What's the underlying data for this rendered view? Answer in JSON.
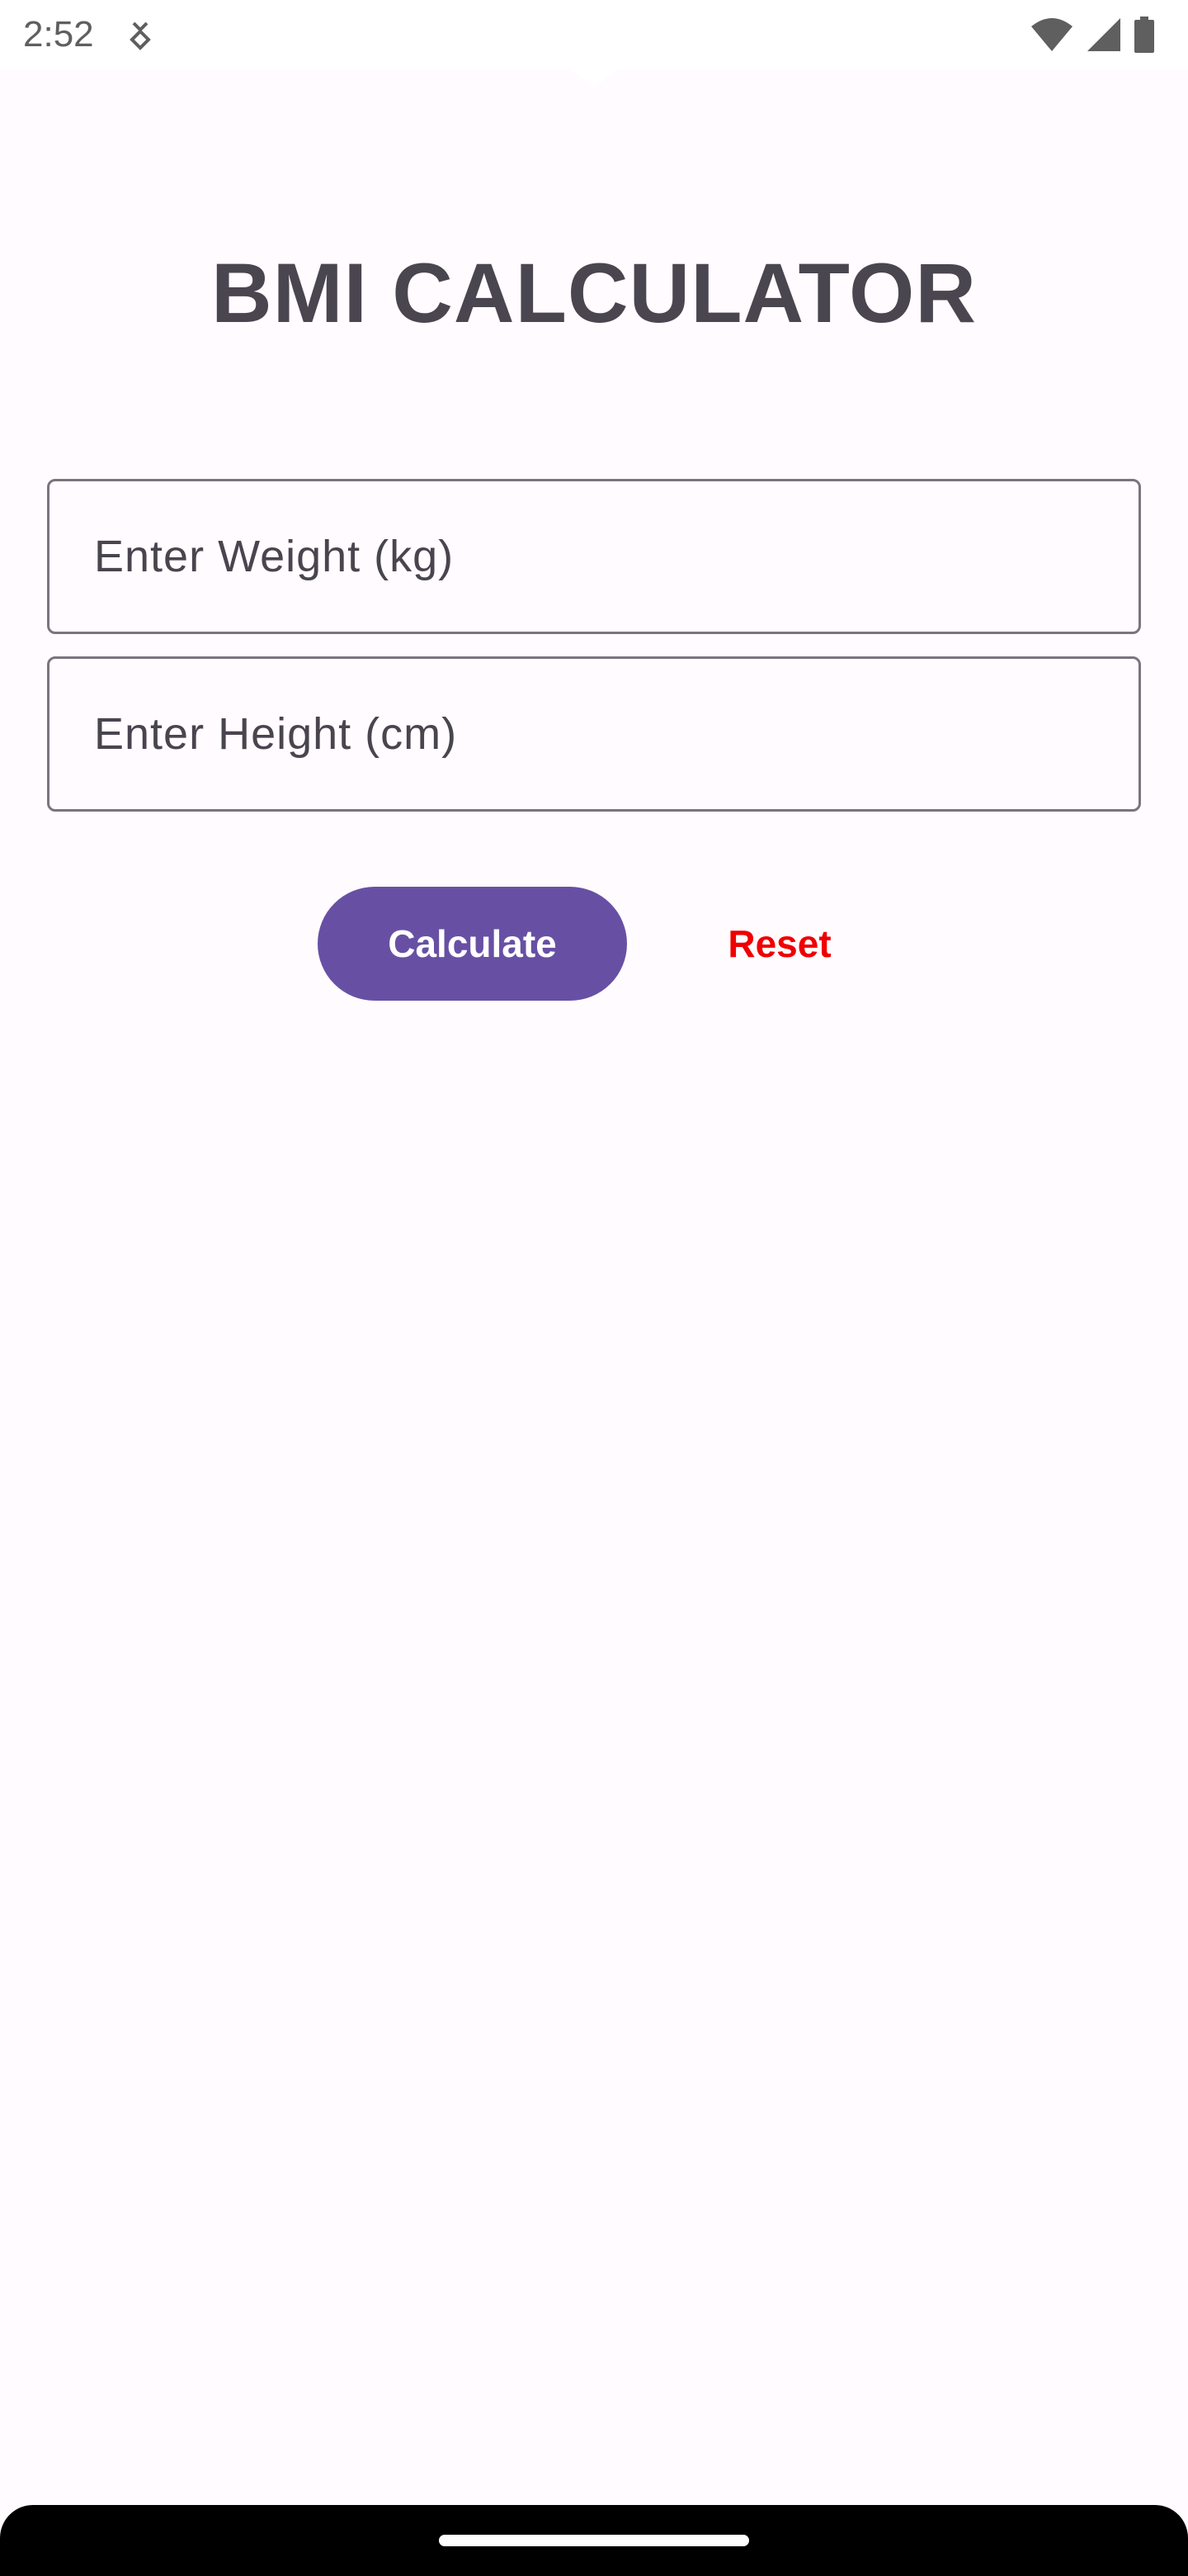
{
  "status_bar": {
    "time": "2:52",
    "app_icon": "notification-app-icon",
    "wifi_icon": "wifi-icon",
    "signal_icon": "cell-signal-icon",
    "battery_icon": "battery-icon"
  },
  "app": {
    "title": "BMI CALCULATOR"
  },
  "form": {
    "weight": {
      "value": "",
      "placeholder": "Enter Weight (kg)"
    },
    "height": {
      "value": "",
      "placeholder": "Enter Height (cm)"
    }
  },
  "actions": {
    "calculate_label": "Calculate",
    "reset_label": "Reset"
  },
  "colors": {
    "background": "#fffbfe",
    "primary": "#6750a4",
    "reset_text": "#f00000",
    "title_text": "#4a4650",
    "outline": "#79747e"
  }
}
